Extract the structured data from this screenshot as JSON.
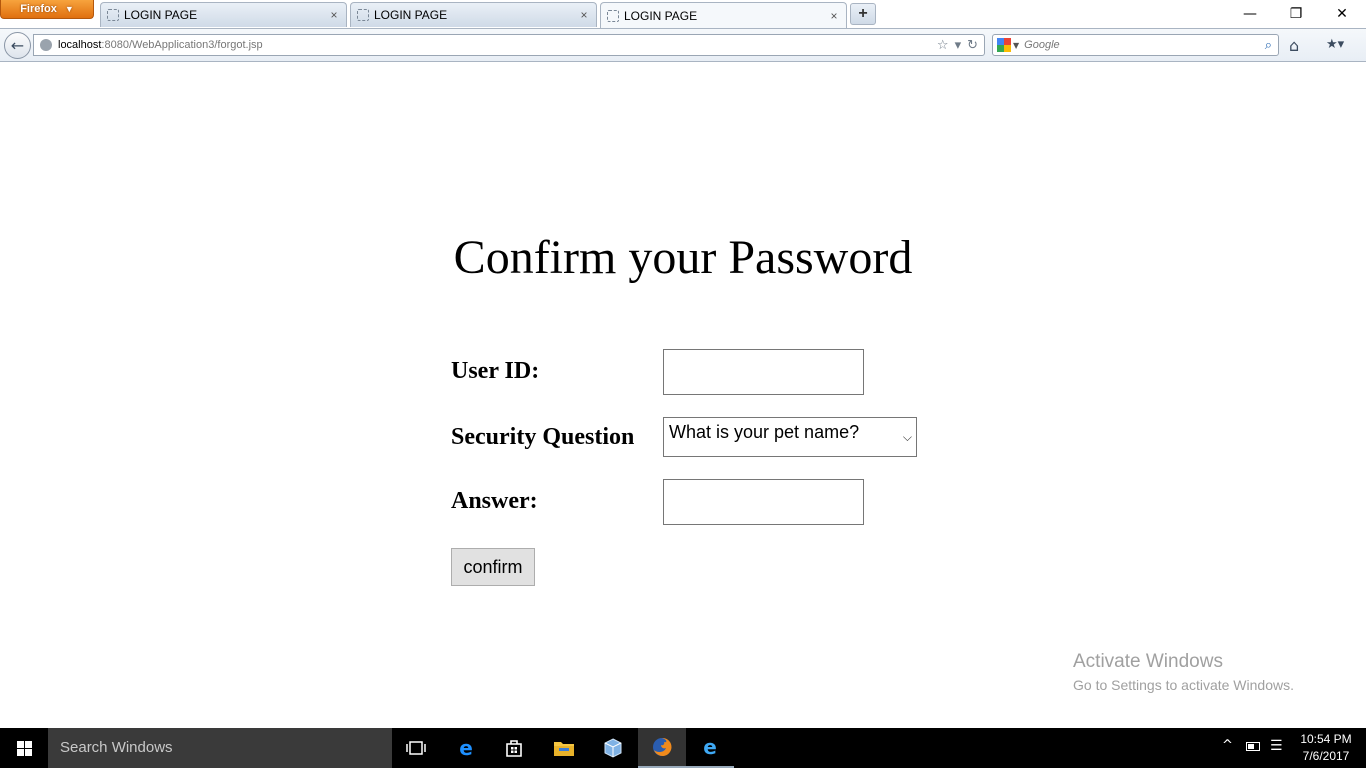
{
  "browser": {
    "app_button": "Firefox",
    "tabs": [
      {
        "title": "LOGIN PAGE",
        "active": false
      },
      {
        "title": "LOGIN PAGE",
        "active": false
      },
      {
        "title": "LOGIN PAGE",
        "active": true
      }
    ],
    "url_host": "localhost",
    "url_rest": ":8080/WebApplication3/forgot.jsp",
    "search_placeholder": "Google",
    "icons": {
      "new_tab": "+",
      "close_tab": "×",
      "minimize": "—",
      "restore": "❐",
      "close_window": "✕",
      "back": "←",
      "star": "☆",
      "dropdown": "▾",
      "reload": "↻",
      "search_go": "⌕",
      "home": "⌂",
      "bookmarks": "★▾"
    }
  },
  "page": {
    "heading": "Confirm your Password",
    "user_id_label": "User ID:",
    "user_id_value": "",
    "security_question_label": "Security Question",
    "security_question_selected": "What is your pet name?",
    "answer_label": "Answer:",
    "answer_value": "",
    "confirm_button": "confirm"
  },
  "watermark": {
    "line1": "Activate Windows",
    "line2": "Go to Settings to activate Windows."
  },
  "taskbar": {
    "search_placeholder": "Search Windows",
    "time": "10:54 PM",
    "date": "7/6/2017",
    "pinned_icons": [
      "task-view-icon",
      "edge-icon",
      "store-icon",
      "file-explorer-icon",
      "virtualbox-icon",
      "firefox-icon",
      "internet-explorer-icon"
    ]
  }
}
